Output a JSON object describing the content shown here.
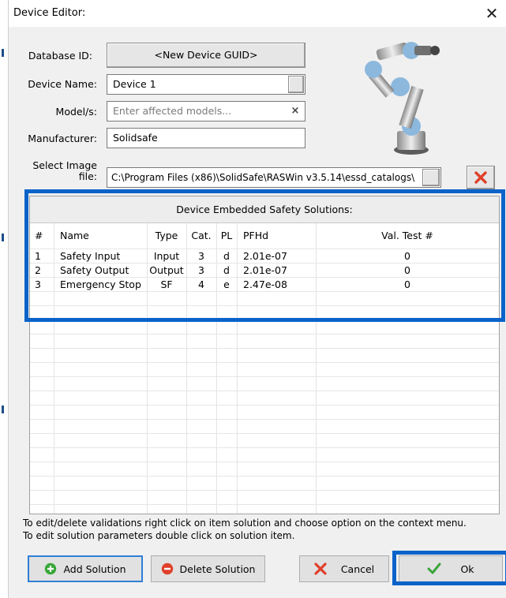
{
  "window": {
    "title": "Device Editor:",
    "close_glyph": "✕"
  },
  "form": {
    "database_id_label": "Database ID:",
    "database_id_value": "<New Device GUID>",
    "device_name_label": "Device Name:",
    "device_name_value": "Device 1",
    "models_label": "Model/s:",
    "models_placeholder": "Enter affected models...",
    "manufacturer_label": "Manufacturer:",
    "manufacturer_value": "Solidsafe",
    "image_label_line1": "Select Image",
    "image_label_line2": "file:",
    "image_path": "C:\\Program Files (x86)\\SolidSafe\\RASWin v3.5.14\\essd_catalogs\\"
  },
  "grid": {
    "title": "Device Embedded Safety Solutions:",
    "columns": [
      "#",
      "Name",
      "Type",
      "Cat.",
      "PL",
      "PFHd",
      "Val. Test #"
    ],
    "rows": [
      [
        "1",
        "Safety Input",
        "Input",
        "3",
        "d",
        "2.01e-07",
        "0"
      ],
      [
        "2",
        "Safety Output",
        "Output",
        "3",
        "d",
        "2.01e-07",
        "0"
      ],
      [
        "3",
        "Emergency Stop",
        "SF",
        "4",
        "e",
        "2.47e-08",
        "0"
      ]
    ]
  },
  "help": {
    "line1": "To edit/delete validations right click on item solution and choose option on the context menu.",
    "line2": "To edit solution parameters double click on solution item."
  },
  "buttons": {
    "add": "Add Solution",
    "delete": "Delete Solution",
    "cancel": "Cancel",
    "ok": "Ok"
  },
  "colors": {
    "highlight": "#0a63c9",
    "delete_red": "#e0402a",
    "ok_green": "#3aa53a",
    "add_green": "#38a838"
  },
  "icons": {
    "robot": "robot-arm-image",
    "clear": "clear-x-icon",
    "remove_image": "red-x-icon"
  }
}
